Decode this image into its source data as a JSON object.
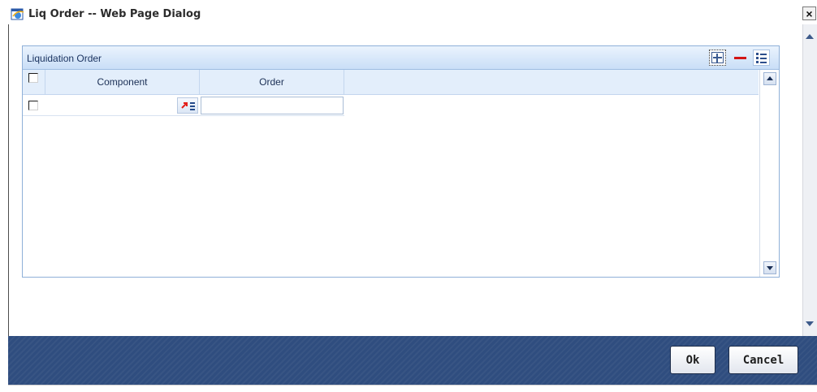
{
  "window": {
    "title": "Liq Order -- Web Page Dialog",
    "close_symbol": "×"
  },
  "panel": {
    "title": "Liquidation Order",
    "toolbar_icons": [
      "add-row-icon",
      "delete-row-icon",
      "single-view-icon"
    ]
  },
  "table": {
    "columns": [
      "Component",
      "Order"
    ],
    "rows": [
      {
        "checked": false,
        "component": "",
        "order": ""
      }
    ]
  },
  "footer": {
    "ok_label": "Ok",
    "cancel_label": "Cancel"
  },
  "colors": {
    "footer_bg": "#2f4d7f",
    "header_bg": "#c9def7",
    "delete_red": "#d21414"
  }
}
